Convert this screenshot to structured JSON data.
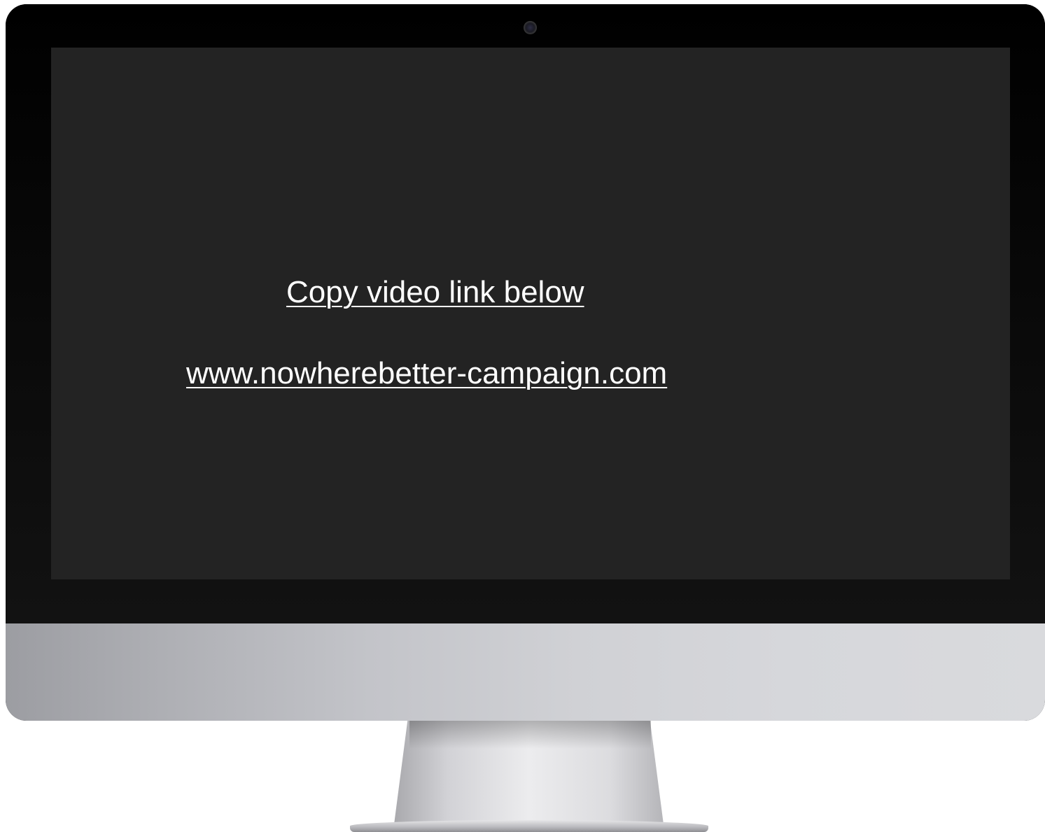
{
  "screen": {
    "instruction_text": "Copy video link below",
    "link_text": "www.nowherebetter-campaign.com"
  },
  "colors": {
    "screen_background": "#232323",
    "bezel": "#000000",
    "text": "#ffffff",
    "chin": "#c8c9cd"
  },
  "icons": {
    "camera": "webcam-icon"
  }
}
